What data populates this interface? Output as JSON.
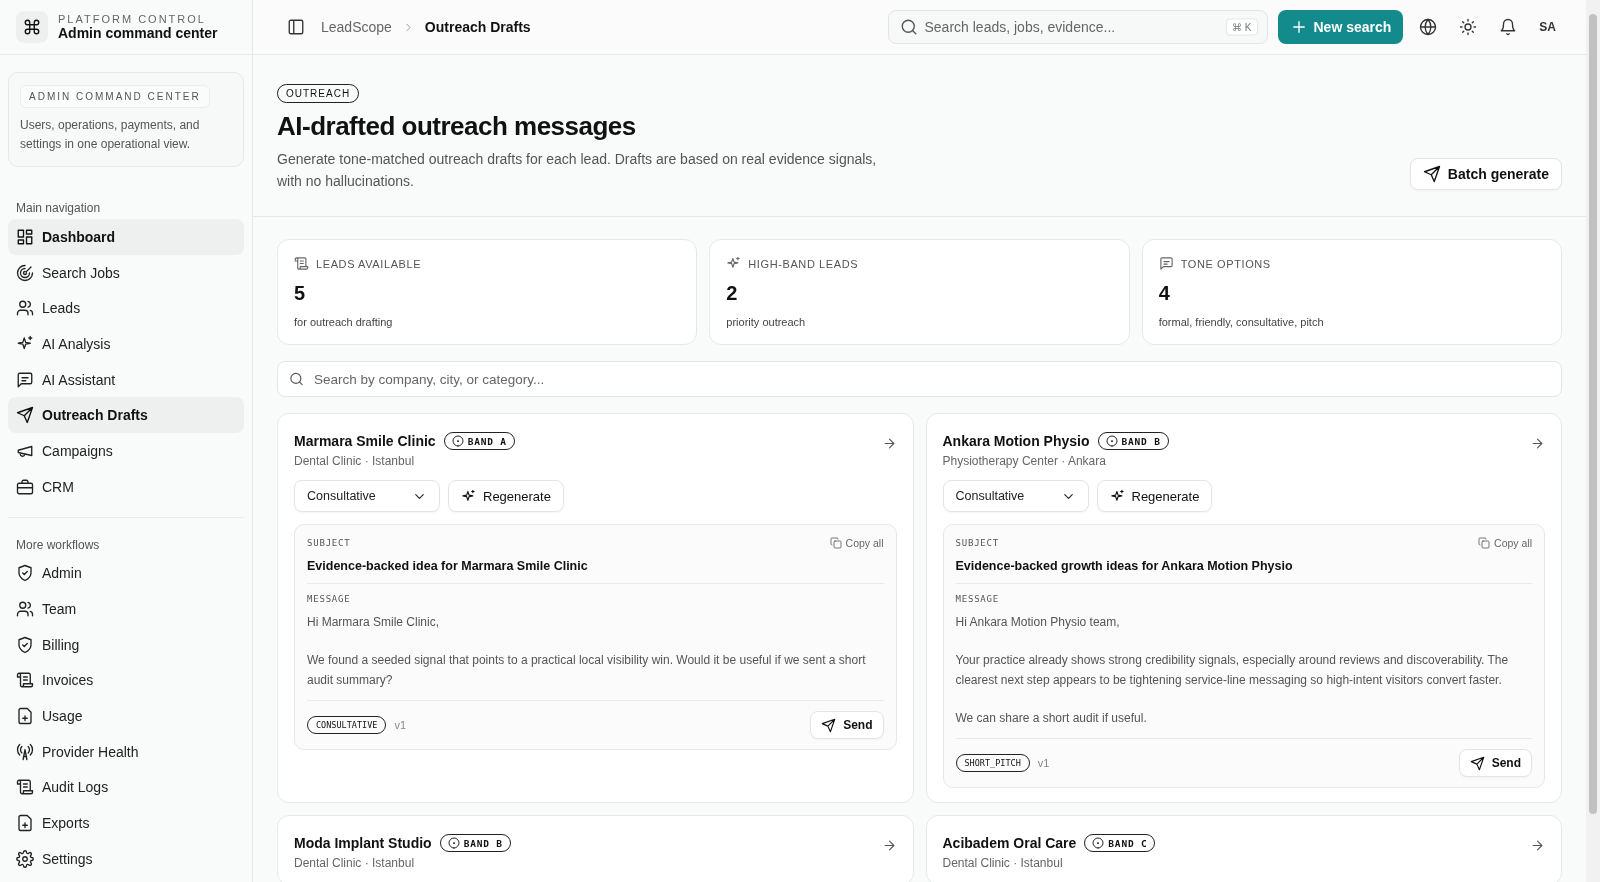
{
  "sidebar": {
    "brand": {
      "eyebrow": "PLATFORM CONTROL",
      "title": "Admin command center"
    },
    "info_card": {
      "badge": "ADMIN COMMAND CENTER",
      "text": "Users, operations, payments, and settings in one operational view."
    },
    "sections": [
      {
        "heading": "Main navigation",
        "items": [
          {
            "label": "Dashboard",
            "selected": true
          },
          {
            "label": "Search Jobs",
            "selected": false
          },
          {
            "label": "Leads",
            "selected": false
          },
          {
            "label": "AI Analysis",
            "selected": false
          },
          {
            "label": "AI Assistant",
            "selected": false
          },
          {
            "label": "Outreach Drafts",
            "selected": true
          },
          {
            "label": "Campaigns",
            "selected": false
          },
          {
            "label": "CRM",
            "selected": false
          }
        ]
      },
      {
        "heading": "More workflows",
        "items": [
          {
            "label": "Admin",
            "selected": false
          },
          {
            "label": "Team",
            "selected": false
          },
          {
            "label": "Billing",
            "selected": false
          },
          {
            "label": "Invoices",
            "selected": false
          },
          {
            "label": "Usage",
            "selected": false
          },
          {
            "label": "Provider Health",
            "selected": false
          },
          {
            "label": "Audit Logs",
            "selected": false
          },
          {
            "label": "Exports",
            "selected": false
          },
          {
            "label": "Settings",
            "selected": false
          }
        ]
      }
    ]
  },
  "topbar": {
    "breadcrumb": [
      "LeadScope",
      "Outreach Drafts"
    ],
    "search": {
      "placeholder": "Search leads, jobs, evidence...",
      "shortcut": "⌘ K"
    },
    "new_search": "New search",
    "avatar": "SA"
  },
  "header": {
    "tag": "OUTREACH",
    "title": "AI-drafted outreach messages",
    "description": "Generate tone-matched outreach drafts for each lead. Drafts are based on real evidence signals, with no hallucinations.",
    "batch_button": "Batch generate"
  },
  "stats": [
    {
      "label": "LEADS AVAILABLE",
      "value": "5",
      "caption": "for outreach drafting"
    },
    {
      "label": "HIGH-BAND LEADS",
      "value": "2",
      "caption": "priority outreach"
    },
    {
      "label": "TONE OPTIONS",
      "value": "4",
      "caption": "formal, friendly, consultative, pitch"
    }
  ],
  "filter": {
    "placeholder": "Search by company, city, or category..."
  },
  "leads": [
    {
      "name": "Marmara Smile Clinic",
      "band": "BAND A",
      "location": "Dental Clinic · Istanbul",
      "tone": "Consultative",
      "regenerate": "Regenerate",
      "subject_label": "SUBJECT",
      "copy": "Copy all",
      "subject": "Evidence-backed idea for Marmara Smile Clinic",
      "message_label": "MESSAGE",
      "message": [
        "Hi Marmara Smile Clinic,",
        "We found a seeded signal that points to a practical local visibility win. Would it be useful if we sent a short audit summary?"
      ],
      "tone_tag": "CONSULTATIVE",
      "version": "v1",
      "send": "Send"
    },
    {
      "name": "Ankara Motion Physio",
      "band": "BAND B",
      "location": "Physiotherapy Center · Ankara",
      "tone": "Consultative",
      "regenerate": "Regenerate",
      "subject_label": "SUBJECT",
      "copy": "Copy all",
      "subject": "Evidence-backed growth ideas for Ankara Motion Physio",
      "message_label": "MESSAGE",
      "message": [
        "Hi Ankara Motion Physio team,",
        "Your practice already shows strong credibility signals, especially around reviews and discoverability. The clearest next step appears to be tightening service-line messaging so high-intent visitors convert faster.",
        "We can share a short audit if useful."
      ],
      "tone_tag": "SHORT_PITCH",
      "version": "v1",
      "send": "Send"
    },
    {
      "name": "Moda Implant Studio",
      "band": "BAND B",
      "location": "Dental Clinic · Istanbul"
    },
    {
      "name": "Acibadem Oral Care",
      "band": "BAND C",
      "location": "Dental Clinic · Istanbul"
    }
  ]
}
